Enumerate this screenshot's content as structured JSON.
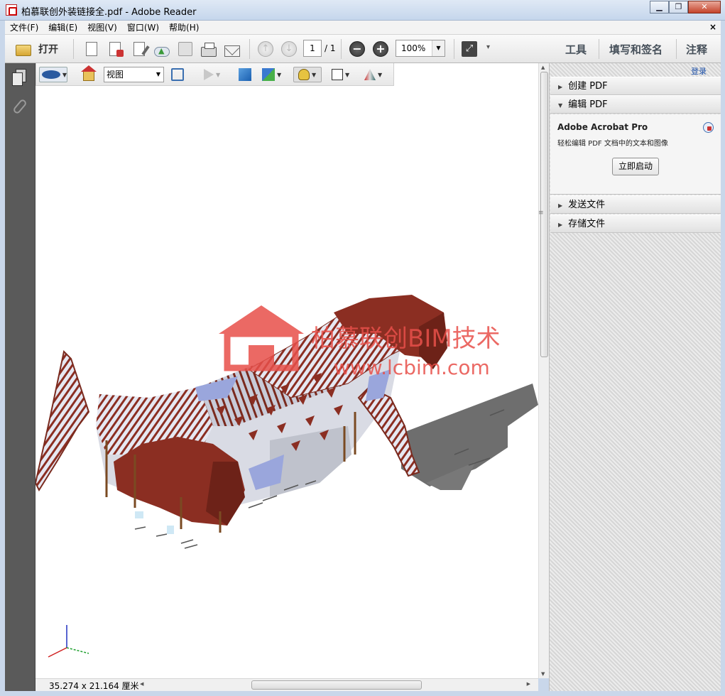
{
  "window": {
    "title": "柏慕联创外装链接全.pdf - Adobe Reader",
    "minimize_symbol": "▁",
    "maximize_symbol": "❐",
    "close_symbol": "✕"
  },
  "menu": {
    "items": [
      "文件(F)",
      "编辑(E)",
      "视图(V)",
      "窗口(W)",
      "帮助(H)"
    ],
    "close_symbol": "×"
  },
  "toolbar": {
    "open_label": "打开",
    "page_current": "1",
    "page_total": "/ 1",
    "zoom_value": "100%",
    "zoom_out_symbol": "−",
    "zoom_in_symbol": "+",
    "prev_symbol": "↑",
    "next_symbol": "↓",
    "tools_label": "工具",
    "fill_sign_label": "填写和签名",
    "comment_label": "注释",
    "expand_symbol": "⤢",
    "overflow_symbol": "▾"
  },
  "toolbar3d": {
    "view_select_value": "视图"
  },
  "watermark": {
    "line1": "柏慕联创BIM技术",
    "line2": "www.lcbim.com"
  },
  "statusbar": {
    "page_dimensions": "35.274 x 21.164 厘米"
  },
  "right_pane": {
    "login_label": "登录",
    "panels": [
      {
        "label": "创建 PDF",
        "expanded": false
      },
      {
        "label": "编辑 PDF",
        "expanded": true
      },
      {
        "label": "发送文件",
        "expanded": false
      },
      {
        "label": "存储文件",
        "expanded": false
      }
    ],
    "edit_pdf": {
      "product": "Adobe Acrobat Pro",
      "description": "轻松编辑 PDF 文档中的文本和图像",
      "button": "立即启动"
    }
  },
  "icons": {
    "app": "adobe-reader-icon",
    "open": "folder-icon",
    "axes": "xyz-axes-icon"
  },
  "colors": {
    "titlebar": "#c5d6ec",
    "model_frame": "#7a2a1e",
    "model_fin": "#8b2e22",
    "model_glass": "#9aa6dc",
    "shadow": "#6e6e6e",
    "watermark": "#e8504a"
  }
}
